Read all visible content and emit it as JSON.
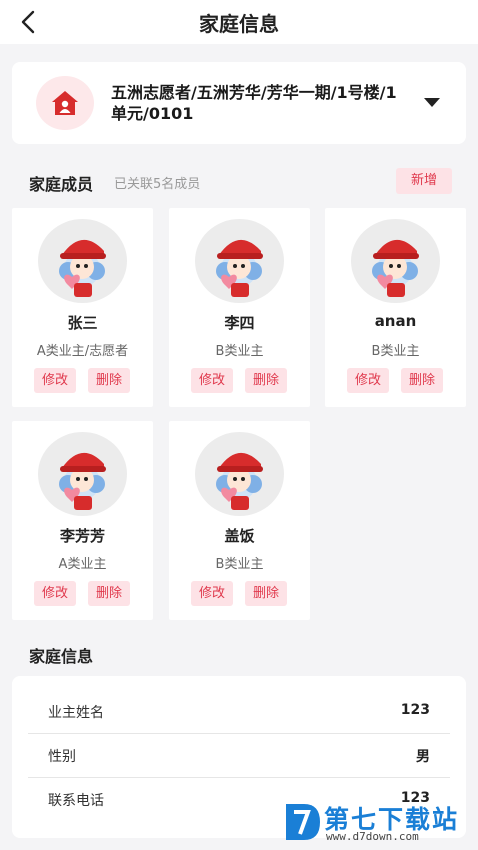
{
  "header": {
    "title": "家庭信息"
  },
  "address": {
    "text": "五洲志愿者/五洲芳华/芳华一期/1号楼/1单元/0101"
  },
  "members_section": {
    "title": "家庭成员",
    "subtitle": "已关联5名成员",
    "add_label": "新增"
  },
  "members": [
    {
      "name": "张三",
      "type": "A类业主/志愿者",
      "edit": "修改",
      "delete": "删除"
    },
    {
      "name": "李四",
      "type": "B类业主",
      "edit": "修改",
      "delete": "删除"
    },
    {
      "name": "anan",
      "type": "B类业主",
      "edit": "修改",
      "delete": "删除"
    },
    {
      "name": "李芳芳",
      "type": "A类业主",
      "edit": "修改",
      "delete": "删除"
    },
    {
      "name": "盖饭",
      "type": "B类业主",
      "edit": "修改",
      "delete": "删除"
    }
  ],
  "info_section": {
    "title": "家庭信息"
  },
  "info": [
    {
      "label": "业主姓名",
      "value": "123"
    },
    {
      "label": "性别",
      "value": "男"
    },
    {
      "label": "联系电话",
      "value": "123"
    }
  ],
  "watermark": {
    "text": "第七下载站",
    "url": "www.d7down.com"
  },
  "icons": {
    "back": "chevron-left-icon",
    "home": "home-icon",
    "dropdown": "caret-down-icon",
    "avatar": "mascot-avatar"
  },
  "colors": {
    "accent": "#e0394d",
    "accent_bg": "#fde2e6",
    "brand_red": "#d72c2c"
  }
}
